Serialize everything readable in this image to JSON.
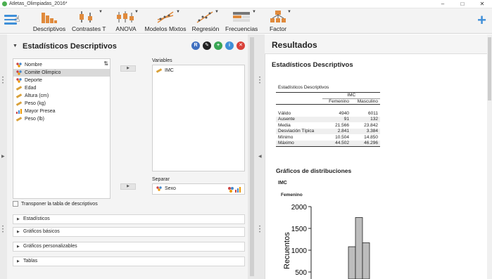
{
  "window": {
    "title": "Atletas_Olimpiadas_2016*",
    "controls": [
      "–",
      "□",
      "✕"
    ]
  },
  "ribbon": {
    "buttons": [
      {
        "label": "Descriptivos",
        "icon": "descriptives-icon",
        "caret": false
      },
      {
        "label": "Contrastes T",
        "icon": "t-tests-icon",
        "caret": true
      },
      {
        "label": "ANOVA",
        "icon": "anova-icon",
        "caret": true
      },
      {
        "label": "Modelos Mixtos",
        "icon": "mixed-models-icon",
        "caret": true
      },
      {
        "label": "Regresión",
        "icon": "regression-icon",
        "caret": true
      },
      {
        "label": "Frecuencias",
        "icon": "frequencies-icon",
        "caret": true
      },
      {
        "label": "Factor",
        "icon": "factor-icon",
        "caret": true
      }
    ],
    "add_symbol": "+"
  },
  "analysis": {
    "title": "Estadísticos Descriptivos",
    "header_icons": [
      {
        "symbol": "R",
        "color": "#3e6fc0"
      },
      {
        "symbol": "✎",
        "color": "#222222"
      },
      {
        "symbol": "+",
        "color": "#3aa655"
      },
      {
        "symbol": "i",
        "color": "#3f8fd8"
      },
      {
        "symbol": "✕",
        "color": "#d9413a"
      }
    ],
    "variables_available": [
      {
        "name": "Nombre",
        "type": "nominal-text"
      },
      {
        "name": "Comite Olimpico",
        "type": "nominal",
        "selected": true
      },
      {
        "name": "Deporte",
        "type": "nominal"
      },
      {
        "name": "Edad",
        "type": "scale"
      },
      {
        "name": "Altura (cm)",
        "type": "scale"
      },
      {
        "name": "Peso (kg)",
        "type": "scale"
      },
      {
        "name": "Mayor Presea",
        "type": "ordinal"
      },
      {
        "name": "Peso (lb)",
        "type": "scale"
      }
    ],
    "variables_label": "Variables",
    "variables_selected": [
      {
        "name": "IMC",
        "type": "scale"
      }
    ],
    "split_label": "Separar",
    "split_selected": [
      {
        "name": "Sexo",
        "type": "nominal"
      }
    ],
    "transpose_label": "Transponer la tabla de descriptivos",
    "sections": [
      "Estadísticos",
      "Gráficos básicos",
      "Gráficos personalizables",
      "Tablas"
    ]
  },
  "results": {
    "title": "Resultados",
    "section_title": "Estadísticos Descriptivos",
    "table_caption": "Estadísticos Descriptivos",
    "variable": "IMC",
    "columns": [
      "Femenino",
      "Masculino"
    ],
    "rows": [
      {
        "label": "Válido",
        "values": [
          "4940",
          "6011"
        ]
      },
      {
        "label": "Ausente",
        "values": [
          "91",
          "132"
        ]
      },
      {
        "label": "Media",
        "values": [
          "21.566",
          "23.842"
        ]
      },
      {
        "label": "Desviación Típica",
        "values": [
          "2.841",
          "3.384"
        ]
      },
      {
        "label": "Mínimo",
        "values": [
          "10.504",
          "14.850"
        ]
      },
      {
        "label": "Máximo",
        "values": [
          "44.502",
          "46.296"
        ]
      }
    ],
    "plots_title": "Gráficos de distribuciones",
    "plot_variable": "IMC",
    "plot_group": "Femenino",
    "y_axis_label": "Recuentos"
  },
  "chart_data": {
    "type": "bar",
    "title": "Femenino",
    "ylabel": "Recuentos",
    "ylim": [
      500,
      2000
    ],
    "yticks": [
      "2000",
      "1500",
      "1000",
      "500"
    ],
    "visible_bars": [
      1080,
      1750,
      1170
    ]
  }
}
